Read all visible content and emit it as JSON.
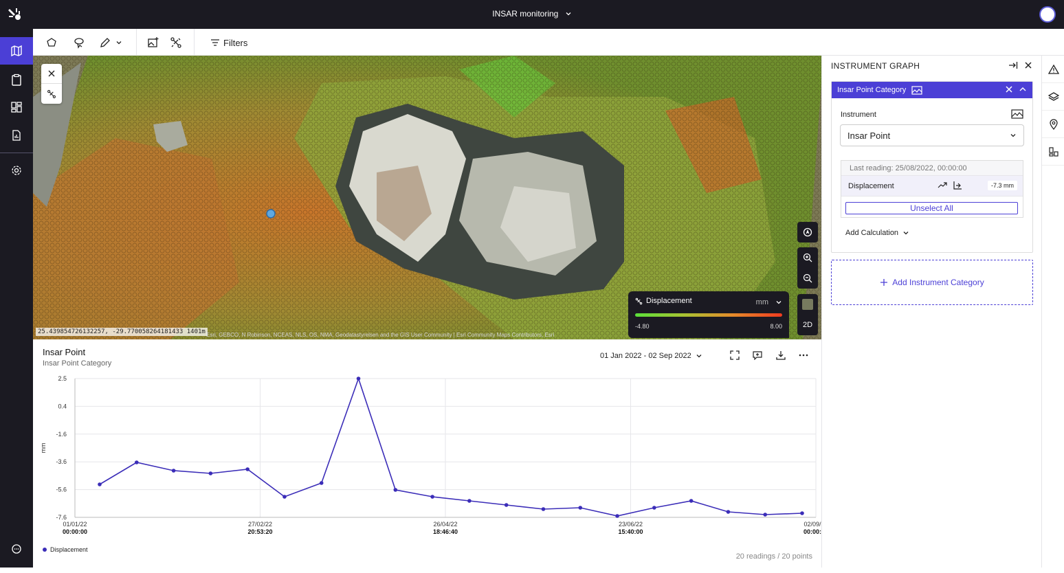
{
  "app": {
    "title": "INSAR monitoring"
  },
  "toolbar": {
    "filters_label": "Filters"
  },
  "map": {
    "coords_text": "25.439854726132257, -29.770058264181433 1401m",
    "attribution": "Esri, GEBCO, N Robinson, NCEAS, NLS, OS, NMA, Geodatastyrelsen and the GIS User Community | Esri Community Maps Contributors, Esri",
    "view_mode": "2D",
    "legend": {
      "title": "Displacement",
      "unit": "mm",
      "min": "-4.80",
      "max": "8.00"
    }
  },
  "chart": {
    "title": "Insar Point",
    "subtitle": "Insar Point Category",
    "date_range": "01 Jan 2022 - 02 Sep 2022",
    "footer": "20 readings / 20 points",
    "legend_label": "Displacement"
  },
  "chart_data": {
    "type": "line",
    "ylabel": "mm",
    "ylim": [
      -7.6,
      2.5
    ],
    "y_ticks": [
      "2.5",
      "0.4",
      "-1.6",
      "-3.6",
      "-5.6",
      "-7.6"
    ],
    "x_ticks": [
      {
        "date": "01/01/22",
        "time": "00:00:00"
      },
      {
        "date": "27/02/22",
        "time": "20:53:20"
      },
      {
        "date": "26/04/22",
        "time": "18:46:40"
      },
      {
        "date": "23/06/22",
        "time": "15:40:00"
      },
      {
        "date": "02/09/22",
        "time": "00:00:00"
      }
    ],
    "series": [
      {
        "name": "Displacement",
        "color": "#3b2db8",
        "values": [
          -5.2,
          -3.6,
          -4.2,
          -4.4,
          -4.1,
          -6.1,
          -5.1,
          2.5,
          -5.6,
          -6.1,
          -6.4,
          -6.7,
          -7.0,
          -6.9,
          -7.5,
          -6.9,
          -6.4,
          -7.2,
          -7.4,
          -7.3
        ]
      }
    ]
  },
  "panel": {
    "title": "INSTRUMENT GRAPH",
    "category_name": "Insar Point Category",
    "instrument_label": "Instrument",
    "instrument_value": "Insar Point",
    "last_reading": "Last reading: 25/08/2022, 00:00:00",
    "reading_label": "Displacement",
    "reading_value": "-7.3 mm",
    "unselect_label": "Unselect All",
    "add_calc_label": "Add Calculation",
    "add_category_label": "Add Instrument Category"
  },
  "colors": {
    "accent": "#4b3fd6",
    "nav_bg": "#1b1a22",
    "series": "#3b2db8"
  }
}
